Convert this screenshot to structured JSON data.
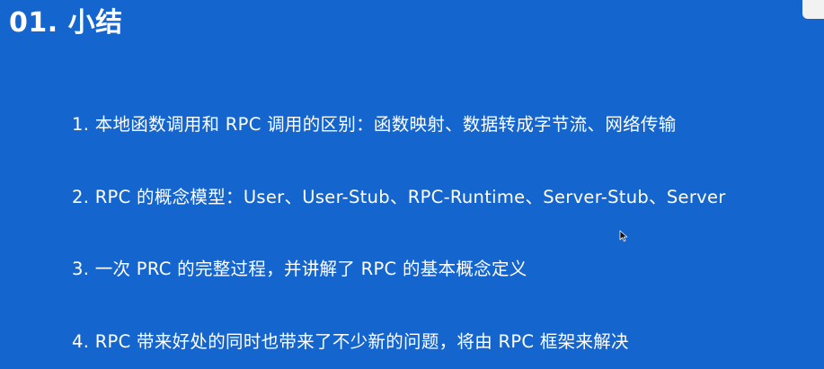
{
  "slide": {
    "title": "01. 小结",
    "items": [
      {
        "label": "1. 本地函数调用和 RPC 调用的区别：函数映射、数据转成字节流、网络传输"
      },
      {
        "label": "2. RPC 的概念模型：User、User-Stub、RPC-Runtime、Server-Stub、Server"
      },
      {
        "label": "3. 一次 PRC 的完整过程，并讲解了 RPC 的基本概念定义"
      },
      {
        "label": "4. RPC 带来好处的同时也带来了不少新的问题，将由 RPC 框架来解决"
      }
    ]
  },
  "colors": {
    "background": "#1565cf",
    "text": "#ffffff",
    "corner_tab": "#f2f2f2"
  },
  "icons": {
    "cursor": "mouse-pointer-icon"
  }
}
